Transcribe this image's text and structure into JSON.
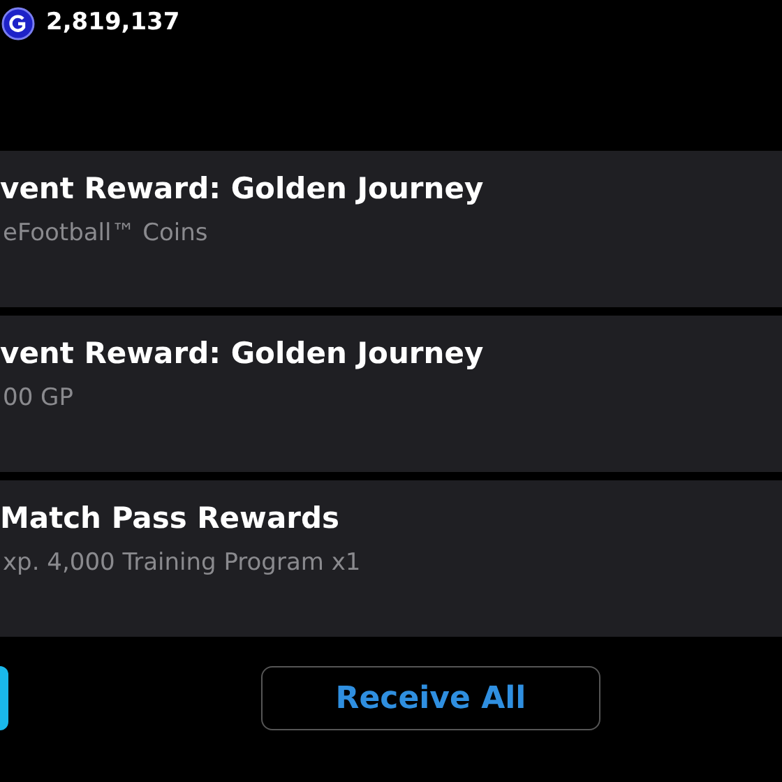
{
  "currency": {
    "amount": "2,819,137"
  },
  "rewards": [
    {
      "title": "vent Reward: Golden Journey",
      "detail": "eFootball™ Coins"
    },
    {
      "title": "vent Reward: Golden Journey",
      "detail": "00 GP"
    },
    {
      "title": "Match Pass Rewards",
      "detail": "xp. 4,000 Training Program x1"
    }
  ],
  "buttons": {
    "receive_all": "Receive All"
  }
}
